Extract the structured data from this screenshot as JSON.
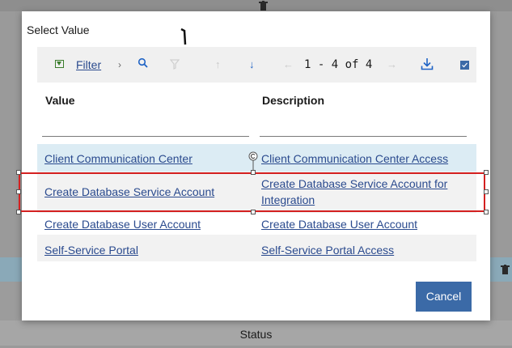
{
  "background": {
    "status_label": "Status"
  },
  "dialog": {
    "title": "Select Value",
    "toolbar": {
      "filter_label": "Filter",
      "pager_text": "1 - 4 of 4"
    },
    "columns": {
      "value_header": "Value",
      "description_header": "Description"
    },
    "rows": [
      {
        "value": "Client Communication Center",
        "description": "Client Communication Center Access"
      },
      {
        "value": "Create Database Service Account",
        "description_line1": "Create Database Service Account for",
        "description_line2": "Integration"
      },
      {
        "value": "Create Database User Account",
        "description": "Create Database User Account"
      },
      {
        "value": "Self-Service Portal",
        "description": "Self-Service Portal Access"
      }
    ],
    "cancel_label": "Cancel"
  }
}
